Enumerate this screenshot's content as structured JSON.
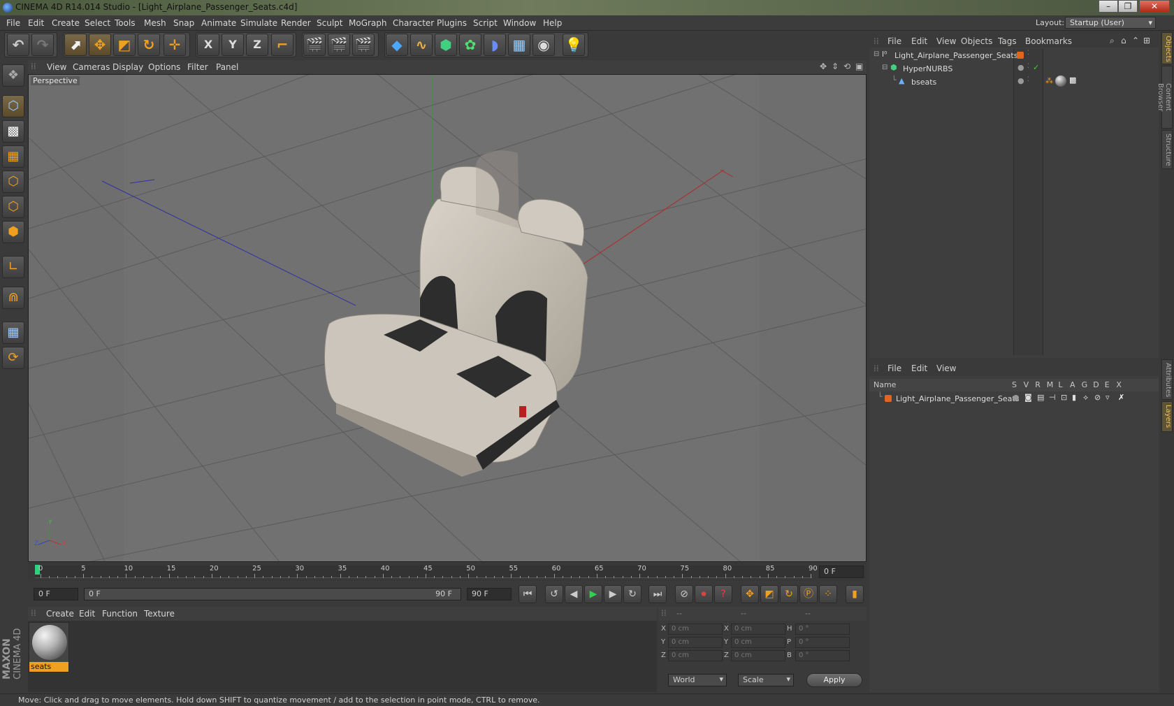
{
  "window": {
    "title": "CINEMA 4D R14.014 Studio - [Light_Airplane_Passenger_Seats.c4d]",
    "minimize": "–",
    "maximize": "❐",
    "close": "✕"
  },
  "menu": [
    "File",
    "Edit",
    "Create",
    "Select",
    "Tools",
    "Mesh",
    "Snap",
    "Animate",
    "Simulate",
    "Render",
    "Sculpt",
    "MoGraph",
    "Character",
    "Plugins",
    "Script",
    "Window",
    "Help"
  ],
  "layout": {
    "label": "Layout:",
    "value": "Startup (User)"
  },
  "toolbar": {
    "axis_x": "X",
    "axis_y": "Y",
    "axis_z": "Z"
  },
  "viewport": {
    "menu": [
      "View",
      "Cameras",
      "Display",
      "Options",
      "Filter",
      "Panel"
    ],
    "label": "Perspective",
    "axis_x": "X",
    "axis_y": "Y",
    "axis_z": "Z"
  },
  "timeline": {
    "ticks": [
      "0",
      "5",
      "10",
      "15",
      "20",
      "25",
      "30",
      "35",
      "40",
      "45",
      "50",
      "55",
      "60",
      "65",
      "70",
      "75",
      "80",
      "85",
      "90"
    ],
    "current_frame": "0 F",
    "start_field": "0 F",
    "range_start": "0 F",
    "range_end": "90 F",
    "end_field": "90 F"
  },
  "materials": {
    "menu": [
      "Create",
      "Edit",
      "Function",
      "Texture"
    ],
    "items": [
      {
        "name": "seats"
      }
    ]
  },
  "coords": {
    "headers": [
      "--",
      "--",
      "--"
    ],
    "rows": [
      {
        "a": "X",
        "av": "0 cm",
        "b": "X",
        "bv": "0 cm",
        "c": "H",
        "cv": "0 °"
      },
      {
        "a": "Y",
        "av": "0 cm",
        "b": "Y",
        "bv": "0 cm",
        "c": "P",
        "cv": "0 °"
      },
      {
        "a": "Z",
        "av": "0 cm",
        "b": "Z",
        "bv": "0 cm",
        "c": "B",
        "cv": "0 °"
      }
    ],
    "mode1": "World",
    "mode2": "Scale",
    "apply": "Apply"
  },
  "objects": {
    "menu": [
      "File",
      "Edit",
      "View",
      "Objects",
      "Tags",
      "Bookmarks"
    ],
    "tree": [
      {
        "name": "Light_Airplane_Passenger_Seats"
      },
      {
        "name": "HyperNURBS"
      },
      {
        "name": "bseats"
      }
    ]
  },
  "layers": {
    "menu": [
      "File",
      "Edit",
      "View"
    ],
    "header_name": "Name",
    "cols": [
      "S",
      "V",
      "R",
      "M",
      "L",
      "A",
      "G",
      "D",
      "E",
      "X"
    ],
    "rows": [
      {
        "name": "Light_Airplane_Passenger_Seats"
      }
    ]
  },
  "sidetabs": [
    "Objects",
    "Content Browser",
    "Structure",
    "Attributes",
    "Layers"
  ],
  "brand": {
    "line1": "MAXON",
    "line2": "CINEMA 4D"
  },
  "status": "Move: Click and drag to move elements. Hold down SHIFT to quantize movement / add to the selection in point mode, CTRL to remove.",
  "colors": {
    "accent": "#f0a020",
    "selection": "#e59a1e",
    "layer_color": "#e0661e"
  }
}
